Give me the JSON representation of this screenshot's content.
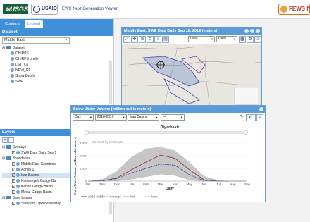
{
  "header": {
    "usgs": "≋USGS",
    "usaid": "USAID",
    "app_title": "EWX Next Generation Viewer",
    "fews": "FEWS NET"
  },
  "left": {
    "tabs": [
      "Contents",
      "Legend"
    ],
    "dataset_head": "Dataset",
    "region": "Middle East",
    "tree_root": "Dataset",
    "datasets": [
      "CHIRPS",
      "CHIRPS prelim",
      "LST_C6",
      "NDVI_C6",
      "Snow Depth",
      "SWE"
    ],
    "layers_head": "Layers",
    "layers": [
      {
        "label": "Overlays",
        "type": "folder"
      },
      {
        "label": "SWE Data Daily Sep 1",
        "type": "check"
      },
      {
        "label": "Boundaries",
        "type": "folder"
      },
      {
        "label": "Middle East Countries",
        "type": "check"
      },
      {
        "label": "Admin 1",
        "type": "check"
      },
      {
        "label": "Iraq Basins",
        "type": "check"
      },
      {
        "label": "Kadaneyeh Gauge Ba",
        "type": "check"
      },
      {
        "label": "Keban Gauge Basin",
        "type": "check"
      },
      {
        "label": "Mosul Gauge Basin",
        "type": "check"
      },
      {
        "label": "Base Layers",
        "type": "folder"
      },
      {
        "label": "Standard OpenStreetMap",
        "type": "check"
      }
    ]
  },
  "map_window": {
    "title": "Middle East: SWE Data Daily Sep 18, 2019 (meters)",
    "data_select": "Data",
    "period_select": "Daily"
  },
  "chart_window": {
    "title": "Snow Water Volume (million cubic meters)",
    "period": "Day",
    "season": "2018-2019",
    "basin": "Iraq Basins",
    "credit": "JS chart by amCharts"
  },
  "chart_data": {
    "type": "line",
    "title": "Diyarbakir",
    "xlabel": "Daily",
    "ylabel": "Snow Water Volume (million cubic meters)",
    "categories": [
      "Oct",
      "Nov",
      "Dec",
      "Jan",
      "Feb",
      "Mar",
      "Apr",
      "May",
      "Jun",
      "Jul",
      "Aug",
      "Sep"
    ],
    "ytick_labels": [
      "0",
      "1,000",
      "2,000",
      "3,000"
    ],
    "ylim": [
      0,
      3000
    ],
    "series": [
      {
        "name": "2018-2019",
        "color": "#8b1a3a",
        "values": [
          0,
          20,
          250,
          900,
          1500,
          2050,
          1800,
          900,
          100,
          0,
          0,
          0
        ]
      },
      {
        "name": "Average",
        "color": "#2e3fb5",
        "values": [
          0,
          30,
          200,
          650,
          1000,
          1350,
          1250,
          500,
          50,
          0,
          0,
          0
        ]
      },
      {
        "name": "Min",
        "color": "#aaaaaa",
        "values": [
          0,
          0,
          20,
          150,
          350,
          550,
          450,
          100,
          0,
          0,
          0,
          0
        ]
      },
      {
        "name": "Max",
        "color": "#cccccc",
        "values": [
          0,
          150,
          800,
          1900,
          2550,
          2700,
          2400,
          1500,
          400,
          50,
          0,
          0
        ]
      }
    ],
    "legend": [
      "2018-2019",
      "Average",
      "Min",
      "Max"
    ],
    "legend_position": "bottom-left"
  }
}
